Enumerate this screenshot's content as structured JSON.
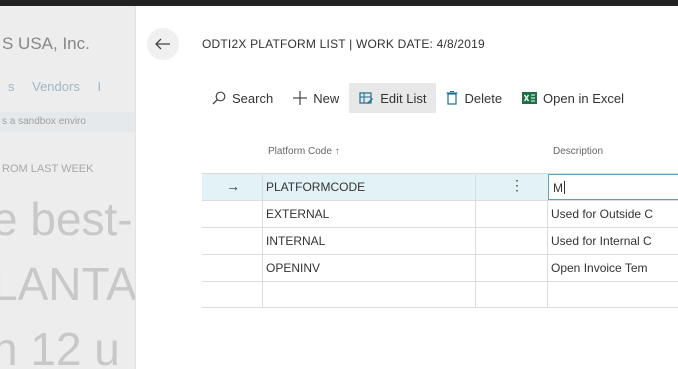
{
  "background": {
    "company": "S USA, Inc.",
    "nav_items": [
      "s",
      "Vendors",
      "I"
    ],
    "sandbox_banner": "s a sandbox enviro",
    "headline_label": "ROM LAST WEEK",
    "big_lines": [
      "e best-",
      "LANTA",
      "n 12 u"
    ]
  },
  "page": {
    "title": "ODTI2X PLATFORM LIST | WORK DATE: 4/8/2019"
  },
  "actions": {
    "search": "Search",
    "new": "New",
    "edit_list": "Edit List",
    "delete": "Delete",
    "open_excel": "Open in Excel"
  },
  "table": {
    "col_code": "Platform Code ↑",
    "col_desc": "Description",
    "rows": [
      {
        "code": "PLATFORMCODE",
        "desc": "M"
      },
      {
        "code": "EXTERNAL",
        "desc": "Used for Outside C"
      },
      {
        "code": "INTERNAL",
        "desc": "Used for Internal C"
      },
      {
        "code": "OPENINV",
        "desc": "Open Invoice Tem"
      },
      {
        "code": "",
        "desc": ""
      }
    ]
  },
  "colors": {
    "accent": "#5fa0bd",
    "selected_row": "#e3f2f6",
    "excel_green": "#1e7145"
  }
}
